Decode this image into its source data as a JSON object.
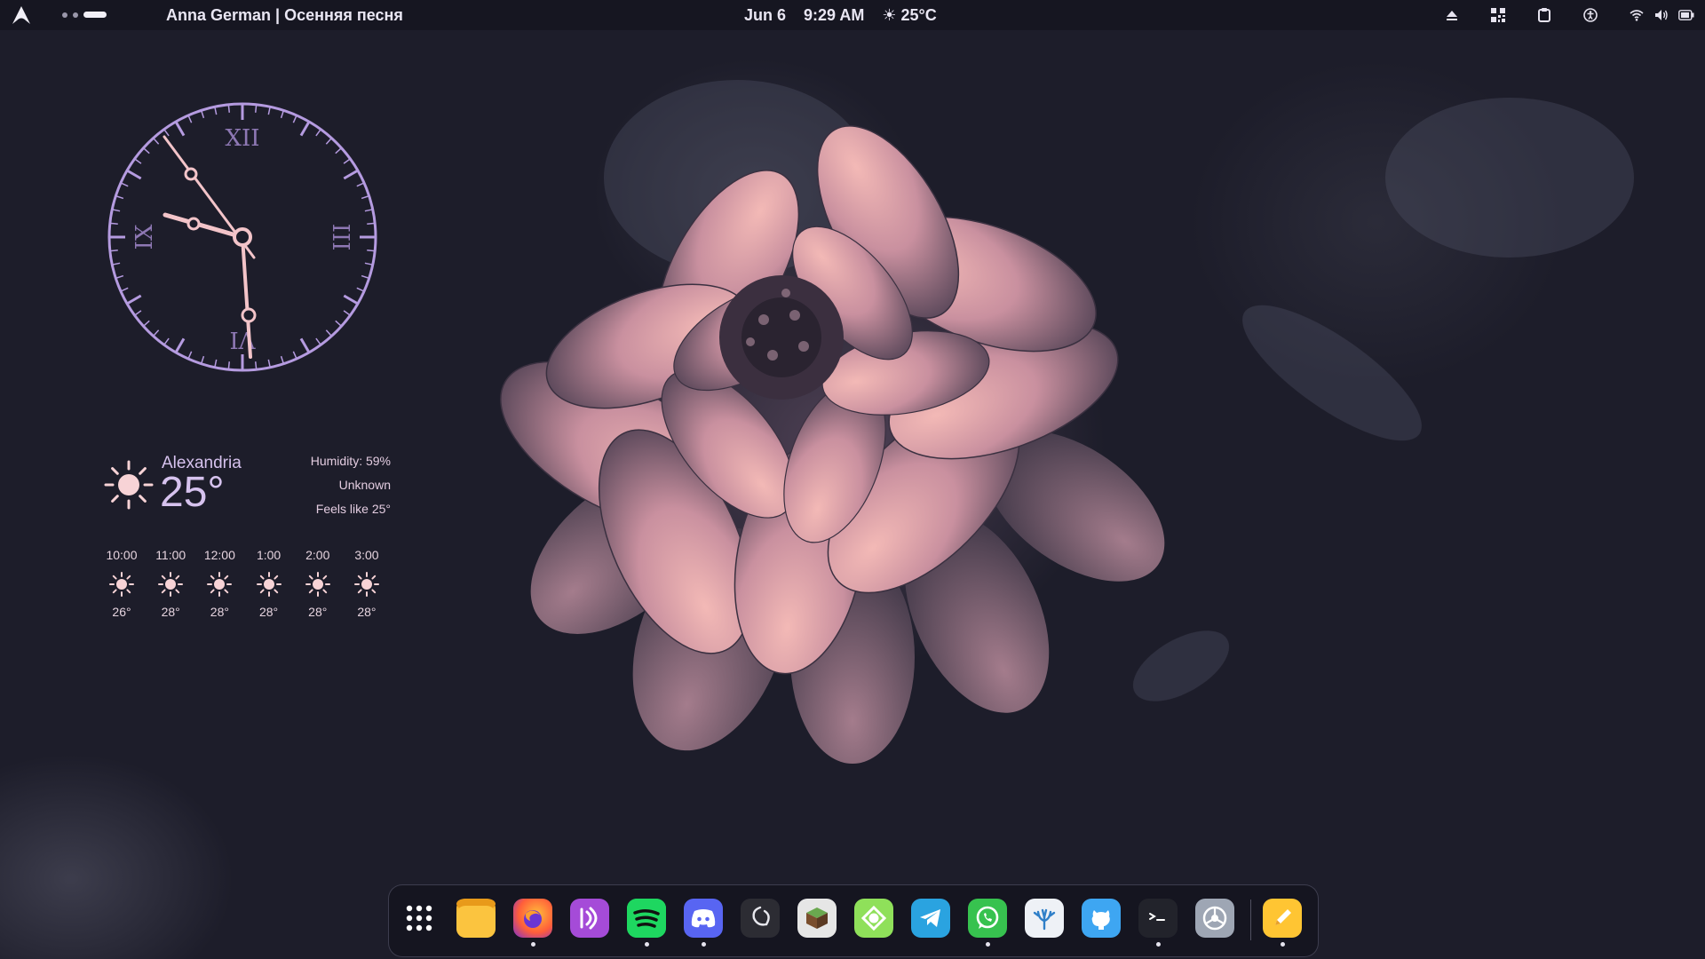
{
  "topbar": {
    "media_title": "Anna German | Осенняя песня",
    "date": "Jun 6",
    "time": "9:29 AM",
    "weather": "☀ 25°C",
    "tray_icons": [
      "eject-icon",
      "qr-code-icon",
      "clipboard-icon",
      "accessibility-icon",
      "wifi-icon",
      "volume-icon",
      "battery-icon"
    ]
  },
  "clock": {
    "numerals": {
      "top": "XII",
      "right": "III",
      "bottom": "VI",
      "left": "IX"
    },
    "accent": "#b59be0",
    "hand_color": "#f3c4c9"
  },
  "weather": {
    "city": "Alexandria",
    "temp": "25°",
    "humidity": "Humidity: 59%",
    "condition": "Unknown",
    "feels_like": "Feels like 25°",
    "forecast": [
      {
        "time": "10:00",
        "temp": "26°"
      },
      {
        "time": "11:00",
        "temp": "28°"
      },
      {
        "time": "12:00",
        "temp": "28°"
      },
      {
        "time": "1:00",
        "temp": "28°"
      },
      {
        "time": "2:00",
        "temp": "28°"
      },
      {
        "time": "3:00",
        "temp": "28°"
      }
    ]
  },
  "dock": {
    "apps": [
      {
        "name": "app-grid-icon",
        "running": false
      },
      {
        "name": "files-icon",
        "running": false
      },
      {
        "name": "firefox-icon",
        "running": true
      },
      {
        "name": "podcasts-icon",
        "running": false
      },
      {
        "name": "spotify-icon",
        "running": true
      },
      {
        "name": "discord-icon",
        "running": true
      },
      {
        "name": "obs-icon",
        "running": false
      },
      {
        "name": "minecraft-icon",
        "running": false
      },
      {
        "name": "sync-icon",
        "running": false
      },
      {
        "name": "telegram-icon",
        "running": false
      },
      {
        "name": "whatsapp-icon",
        "running": true
      },
      {
        "name": "coral-app-icon",
        "running": false
      },
      {
        "name": "github-icon",
        "running": false
      },
      {
        "name": "terminal-icon",
        "running": true
      },
      {
        "name": "settings-icon",
        "running": false
      },
      {
        "name": "notes-icon",
        "running": true
      }
    ]
  }
}
